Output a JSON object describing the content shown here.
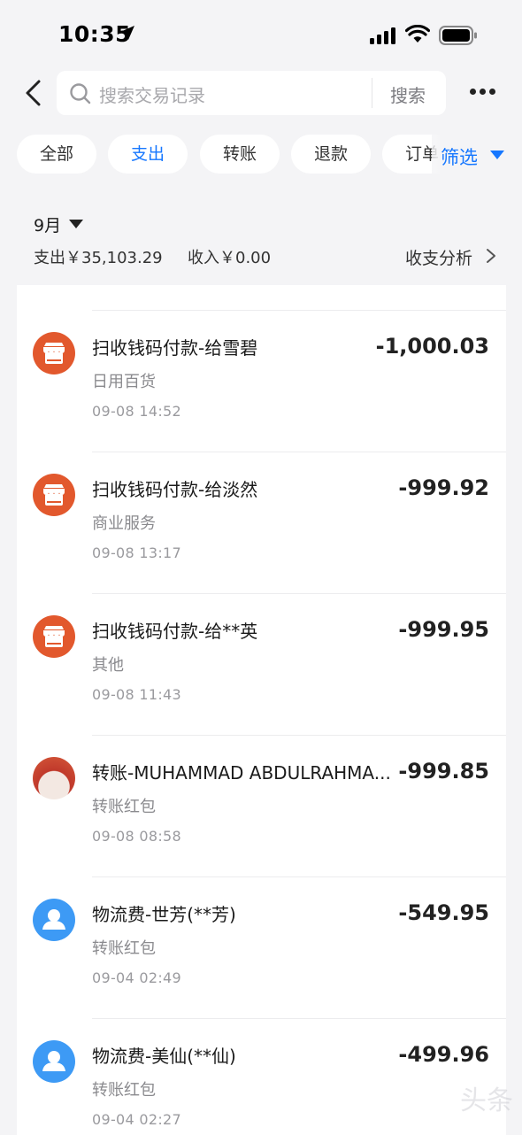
{
  "status_bar": {
    "time": "10:35"
  },
  "search": {
    "placeholder": "搜索交易记录",
    "submit_label": "搜索"
  },
  "filters": {
    "chips": [
      "全部",
      "支出",
      "转账",
      "退款",
      "订单"
    ],
    "active_index": 1,
    "filter_label": "筛选"
  },
  "summary": {
    "month": "9月",
    "expense": "支出￥35,103.29",
    "income": "收入￥0.00",
    "analysis": "收支分析"
  },
  "transactions": [
    {
      "title": "扫收钱码付款-给雪碧",
      "category": "日用百货",
      "datetime": "09-08 14:52",
      "amount": "-1,000.03",
      "avatar": "shop-icon"
    },
    {
      "title": "扫收钱码付款-给淡然",
      "category": "商业服务",
      "datetime": "09-08 13:17",
      "amount": "-999.92",
      "avatar": "shop-icon"
    },
    {
      "title": "扫收钱码付款-给**英",
      "category": "其他",
      "datetime": "09-08 11:43",
      "amount": "-999.95",
      "avatar": "shop-icon"
    },
    {
      "title": "转账-MUHAMMAD ABDULRAHMA...",
      "category": "转账红包",
      "datetime": "09-08 08:58",
      "amount": "-999.85",
      "avatar": "photo"
    },
    {
      "title": "物流费-世芳(**芳)",
      "category": "转账红包",
      "datetime": "09-04 02:49",
      "amount": "-549.95",
      "avatar": "user-icon"
    },
    {
      "title": "物流费-美仙(**仙)",
      "category": "转账红包",
      "datetime": "09-04 02:27",
      "amount": "-499.96",
      "avatar": "user-icon"
    }
  ],
  "colors": {
    "accent": "#1677ff",
    "shop_icon": "#e2582d",
    "user_icon": "#3d9af5"
  }
}
